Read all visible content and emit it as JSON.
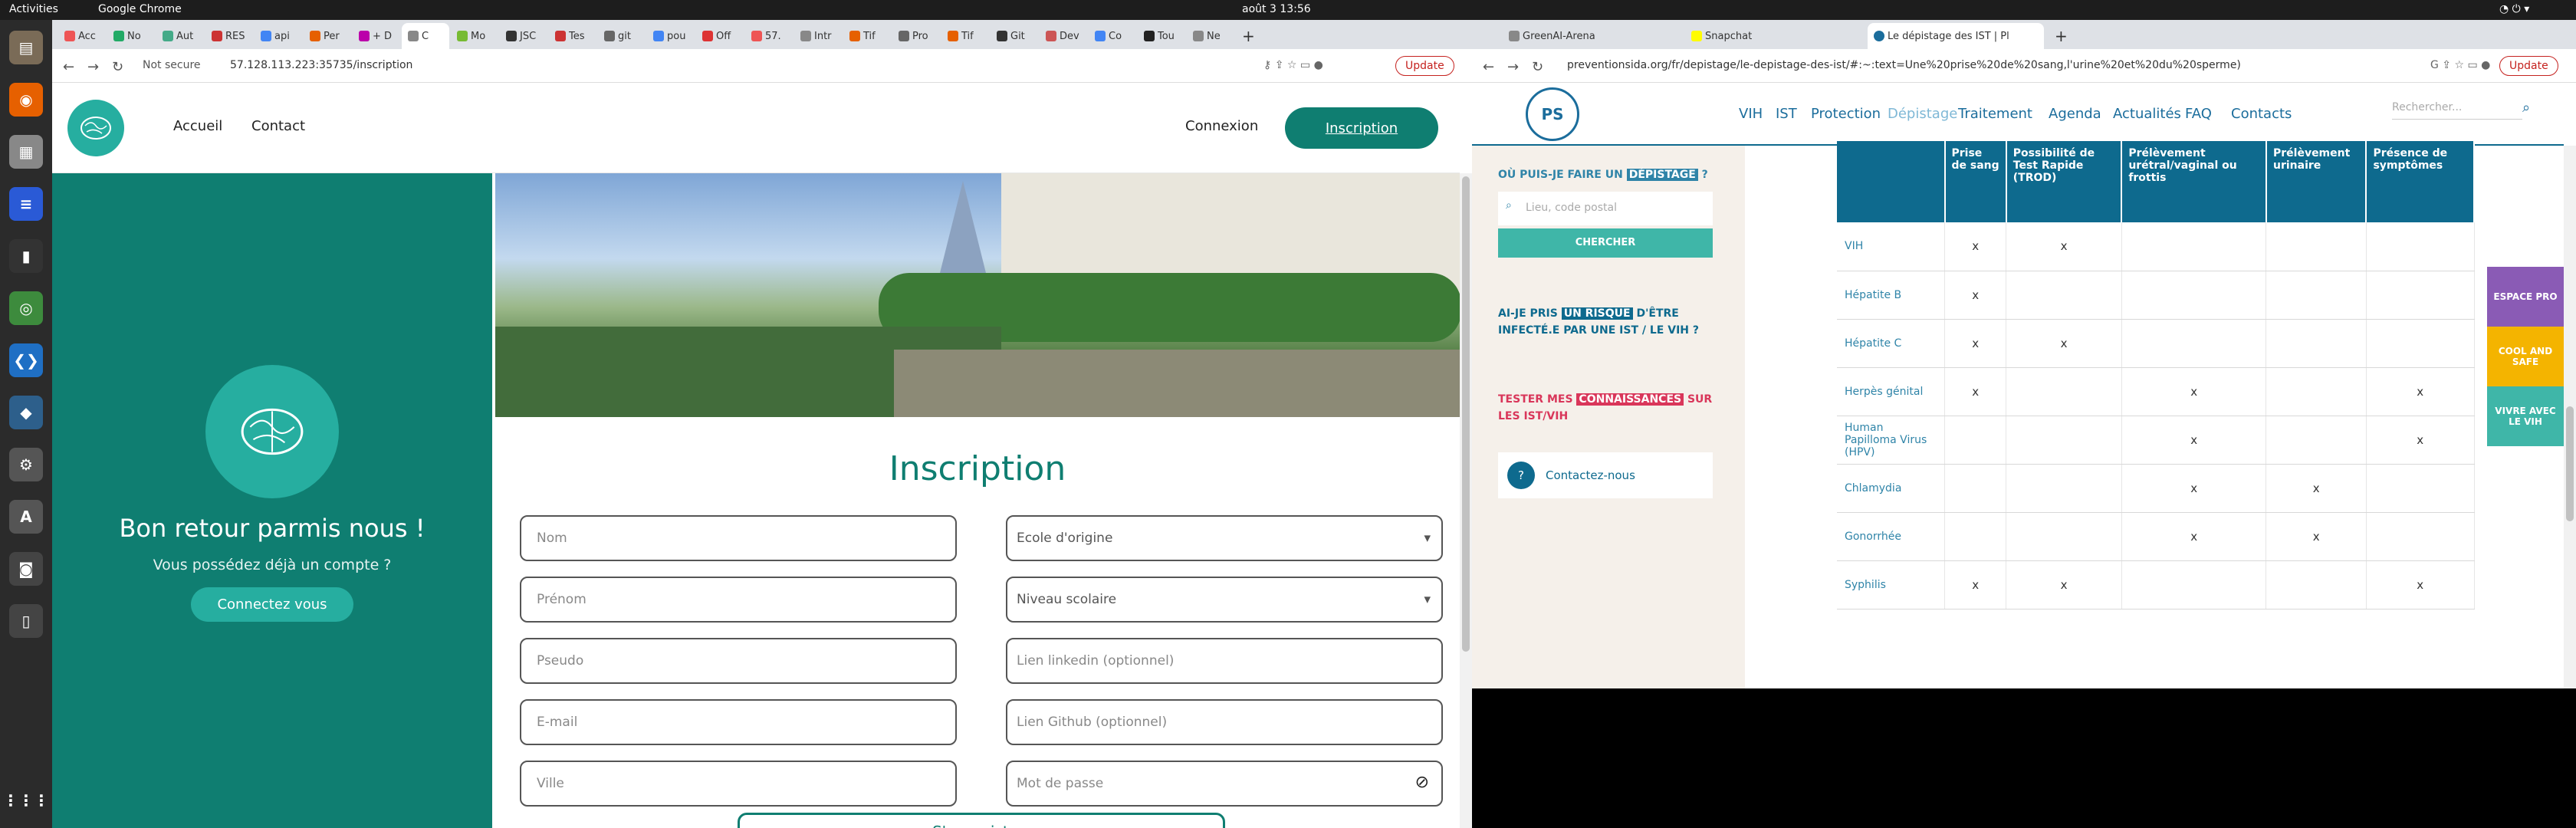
{
  "system": {
    "activities": "Activities",
    "app_name": "Google Chrome",
    "clock": "août 3  13:56"
  },
  "left": {
    "tabs": [
      "Acc",
      "No",
      "Aut",
      "RES",
      "api",
      "Per",
      "+ D",
      "C",
      "Mo",
      "JSC",
      "Tes",
      "git",
      "pou",
      "Off",
      "57.",
      "Intr",
      "Tif",
      "Pro",
      "Tif",
      "Git",
      "Dev",
      "Co",
      "Tou",
      "Ne"
    ],
    "address_prefix": "Not secure",
    "url": "57.128.113.223:35735/inscription",
    "update_label": "Update",
    "nav": {
      "home": "Accueil",
      "contact": "Contact",
      "login": "Connexion",
      "signup": "Inscription"
    },
    "panel": {
      "title": "Bon retour parmis nous !",
      "subtitle": "Vous possédez déjà un compte ?",
      "button": "Connectez vous"
    },
    "form": {
      "title": "Inscription",
      "left_fields": [
        "Nom",
        "Prénom",
        "Pseudo",
        "E-mail",
        "Ville"
      ],
      "right_fields": [
        "Ecole d'origine",
        "Niveau scolaire",
        "Lien linkedin (optionnel)",
        "Lien Github (optionnel)",
        "Mot de passe"
      ],
      "submit": "S'enregistrer"
    }
  },
  "right": {
    "tabs": [
      "GreenAI-Arena",
      "Snapchat",
      "Le dépistage des IST | Pl"
    ],
    "url": "preventionsida.org/fr/depistage/le-depistage-des-ist/#:~:text=Une%20prise%20de%20sang,l'urine%20et%20du%20sperme)",
    "update_label": "Update",
    "menu": [
      "VIH",
      "IST",
      "Protection",
      "Dépistage",
      "Traitement",
      "Agenda",
      "Actualités",
      "FAQ",
      "Contacts"
    ],
    "search_placeholder": "Rechercher...",
    "sidebar": {
      "q1_a": "OÙ PUIS-JE FAIRE UN",
      "q1_b": "DÉPISTAGE",
      "q1_c": "?",
      "location_placeholder": "Lieu, code postal",
      "search_button": "CHERCHER",
      "q2_a": "AI-JE PRIS",
      "q2_b": "UN RISQUE",
      "q2_c": "D'ÊTRE INFECTÉ.E PAR UNE IST / LE VIH ?",
      "q3_a": "TESTER MES",
      "q3_b": "CONNAISSANCES",
      "q3_c": "SUR LES IST/VIH",
      "contact": "Contactez-nous"
    },
    "table": {
      "headers": [
        "",
        "Prise de sang",
        "Possibilité de Test Rapide (TROD)",
        "Prélèvement urétral/vaginal ou frottis",
        "Prélèvement urinaire",
        "Présence de symptômes"
      ],
      "rows": [
        [
          "VIH",
          "x",
          "x",
          "",
          "",
          ""
        ],
        [
          "Hépatite B",
          "x",
          "",
          "",
          "",
          ""
        ],
        [
          "Hépatite C",
          "x",
          "x",
          "",
          "",
          ""
        ],
        [
          "Herpès génital",
          "x",
          "",
          "x",
          "",
          "x"
        ],
        [
          "Human Papilloma Virus (HPV)",
          "",
          "",
          "x",
          "",
          "x"
        ],
        [
          "Chlamydia",
          "",
          "",
          "x",
          "x",
          ""
        ],
        [
          "Gonorrhée",
          "",
          "",
          "x",
          "x",
          ""
        ],
        [
          "Syphilis",
          "x",
          "x",
          "",
          "",
          "x"
        ]
      ]
    },
    "side_pills": [
      "ESPACE PRO",
      "COOL AND SAFE",
      "VIVRE AVEC LE VIH"
    ]
  }
}
